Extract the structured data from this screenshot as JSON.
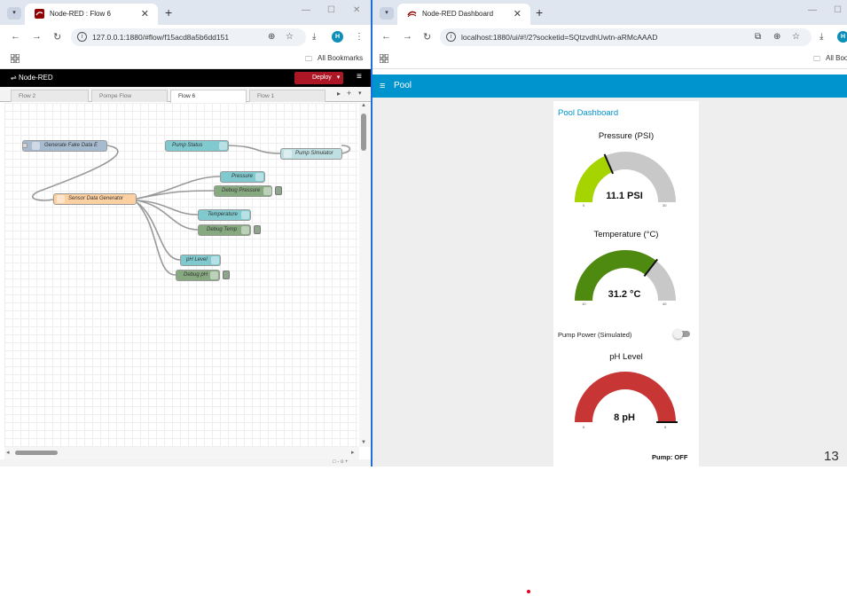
{
  "left_window": {
    "tab_title": "Node-RED : Flow 6",
    "url": "127.0.0.1:1880/#flow/f15acd8a5b6dd151",
    "bookmarks_label": "All Bookmarks",
    "app_title": "Node-RED",
    "deploy_label": "Deploy",
    "flow_tabs": [
      "Flow 2",
      "Pompe Flow",
      "Flow 6",
      "Flow 1"
    ],
    "active_flow_tab": "Flow 6",
    "nodes": {
      "inject": "Generate Fake Data E",
      "function": "Sensor Data Generator",
      "pump_status": "Pump Status",
      "pump_simulator": "Pump Simulator",
      "pressure_gauge": "Pressure",
      "debug_pressure": "Debug Pressure",
      "temp_gauge": "Temperature",
      "debug_temp": "Debug Temp",
      "ph_gauge": "pH Level",
      "debug_ph": "Debug pH"
    }
  },
  "right_window": {
    "tab_title": "Node-RED Dashboard",
    "url": "localhost:1880/ui/#!/2?socketid=SQtzvdhUwtn-aRMcAAAD",
    "bookmarks_label": "All Boo",
    "page_title": "Pool",
    "group_title": "Pool Dashboard",
    "gauges": [
      {
        "title": "Pressure (PSI)",
        "value_text": "11.1 PSI",
        "min": "0",
        "max": "30",
        "fraction": 0.37,
        "color": "#a6d400"
      },
      {
        "title": "Temperature (°C)",
        "value_text": "31.2 °C",
        "min": "10",
        "max": "40",
        "fraction": 0.71,
        "color": "#4f8a10"
      },
      {
        "title": "pH Level",
        "value_text": "8 pH",
        "min": "6",
        "max": "8",
        "fraction": 1.0,
        "color": "#c73535"
      }
    ],
    "switch_label": "Pump Power (Simulated)",
    "pump_text": "Pump: OFF"
  },
  "page_number": "13",
  "colors": {
    "nodered_header": "#000000",
    "deploy": "#ad1625",
    "dashboard_header": "#0094ce",
    "gauge_track": "#c8c8c8"
  }
}
